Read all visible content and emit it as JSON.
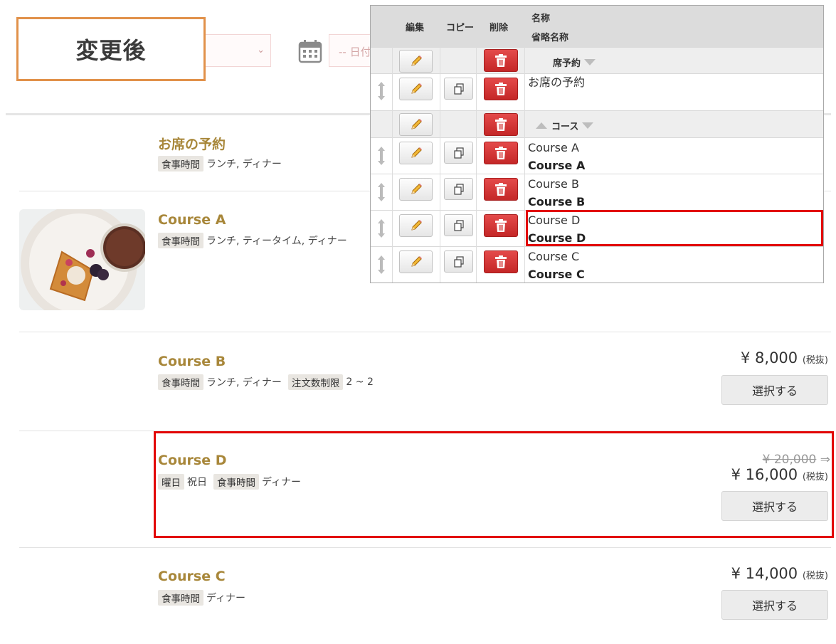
{
  "filter_bar": {
    "after_label": "変更後",
    "date_placeholder": "-- 日付"
  },
  "courses": [
    {
      "title": "お席の予約",
      "tags": [
        {
          "label": "食事時間",
          "value": "ランチ, ディナー"
        }
      ]
    },
    {
      "title": "Course A",
      "tags": [
        {
          "label": "食事時間",
          "value": "ランチ, ティータイム, ディナー"
        }
      ]
    },
    {
      "title": "Course B",
      "tags": [
        {
          "label": "食事時間",
          "value": "ランチ, ディナー"
        },
        {
          "label": "注文数制限",
          "value": "2 ~ 2"
        }
      ],
      "price": "¥ 8,000",
      "tax": "(税抜)",
      "button": "選択する"
    },
    {
      "title": "Course D",
      "tags": [
        {
          "label": "曜日",
          "value": "祝日"
        },
        {
          "label": "食事時間",
          "value": "ディナー"
        }
      ],
      "old_price": "¥ 20,000",
      "arrow": "⇒",
      "price": "¥ 16,000",
      "tax": "(税抜)",
      "button": "選択する"
    },
    {
      "title": "Course C",
      "tags": [
        {
          "label": "食事時間",
          "value": "ディナー"
        }
      ],
      "price": "¥ 14,000",
      "tax": "(税抜)",
      "button": "選択する"
    }
  ],
  "admin": {
    "headers": {
      "edit": "編集",
      "copy": "コピー",
      "delete": "削除",
      "name": "名称",
      "short_name": "省略名称"
    },
    "categories": [
      {
        "label": "席予約"
      },
      {
        "label": "コース"
      }
    ],
    "rows": [
      {
        "name": "お席の予約",
        "short": ""
      },
      {
        "name": "Course A",
        "short": "Course A"
      },
      {
        "name": "Course B",
        "short": "Course B"
      },
      {
        "name": "Course D",
        "short": "Course D"
      },
      {
        "name": "Course C",
        "short": "Course C"
      }
    ]
  },
  "colors": {
    "course_title": "#a8873a",
    "highlight": "#e20000",
    "after_label_border": "#e1914a",
    "delete_button": "#d63a3a"
  }
}
